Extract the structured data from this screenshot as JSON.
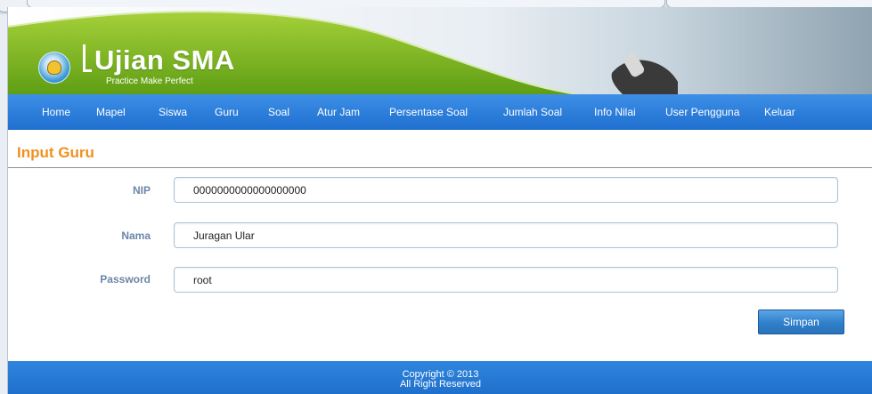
{
  "header": {
    "brand_title": "Ujian SMA",
    "brand_subtitle": "Practice Make Perfect",
    "colors": {
      "green": "#8fc31f",
      "dark_green": "#5c9a12",
      "nav_blue": "#2a7ad8"
    }
  },
  "nav": {
    "items": [
      "Home",
      "Mapel",
      "Siswa",
      "Guru",
      "Soal",
      "Atur Jam",
      "Persentase Soal",
      "Jumlah Soal",
      "Info Nilai",
      "User Pengguna",
      "Keluar"
    ]
  },
  "form": {
    "title": "Input Guru",
    "fields": [
      {
        "label": "NIP",
        "value": "0000000000000000000"
      },
      {
        "label": "Nama",
        "value": "Juragan Ular"
      },
      {
        "label": "Password",
        "value": "root"
      }
    ],
    "submit_label": "Simpan"
  },
  "footer": {
    "line1": "Copyright © 2013",
    "line2": "All Right Reserved"
  }
}
